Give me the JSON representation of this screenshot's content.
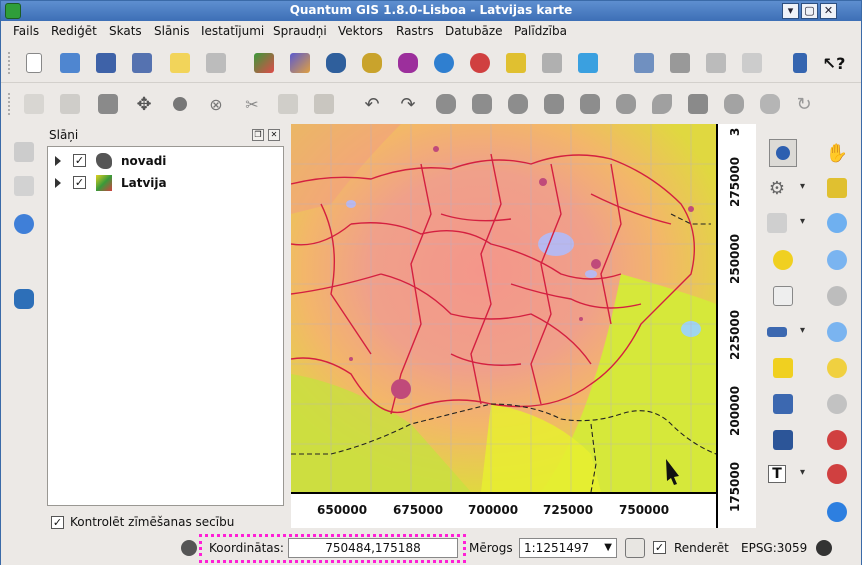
{
  "window": {
    "title": "Quantum GIS 1.8.0-Lisboa - Latvijas karte",
    "minimize": "▾",
    "maximize": "▢",
    "close": "✕"
  },
  "menu": [
    "Fails",
    "Rediģēt",
    "Skats",
    "Slānis",
    "Iestatījumi",
    "Spraudņi",
    "Vektors",
    "Rastrs",
    "Datubāze",
    "Palīdzība"
  ],
  "toolbar_top_icons": [
    "new-project-icon",
    "open-project-icon",
    "save-project-icon",
    "save-as-icon",
    "new-print-composer-icon",
    "print-icon",
    "add-raster-layer-icon",
    "add-wms-layer-icon",
    "add-postgis-layer-icon",
    "add-spatialite-layer-icon",
    "add-mssql-layer-icon",
    "add-wfs-layer-icon",
    "add-delimited-text-icon",
    "add-gpx-icon",
    "remove-layer-icon",
    "new-vector-layer-icon",
    "spell-check-icon",
    "measure-icon",
    "tag-icon",
    "plugin-icon",
    "help-book-icon",
    "whats-this-icon"
  ],
  "toolbar_edit_icons": [
    "edit-pencil-icon",
    "save-edits-icon",
    "add-feature-icon",
    "move-feature-icon",
    "node-tool-icon",
    "delete-selected-icon",
    "cut-icon",
    "copy-icon",
    "paste-icon",
    "undo-icon",
    "redo-icon",
    "simplify-icon",
    "add-ring-icon",
    "add-part-icon",
    "delete-ring-icon",
    "delete-part-icon",
    "reshape-icon",
    "offset-curve-icon",
    "split-icon",
    "merge-icon",
    "merge-attributes-icon",
    "rotate-icon"
  ],
  "layers_panel": {
    "title": "Slāņi",
    "layers": [
      {
        "name": "novadi",
        "checked": true,
        "icon": "polygon-layer-icon"
      },
      {
        "name": "Latvija",
        "checked": true,
        "icon": "raster-layer-icon"
      }
    ],
    "render_order_label": "Kontrolēt zīmēšanas secību",
    "render_order_checked": true
  },
  "map": {
    "x_ticks": [
      "650000",
      "675000",
      "700000",
      "725000",
      "750000"
    ],
    "y_ticks": [
      "275000",
      "250000",
      "225000",
      "200000",
      "175000"
    ],
    "y_top_label": "3"
  },
  "status": {
    "coord_label": "Koordinātas:",
    "coord_value": "750484,175188",
    "scale_label": "Mērogs",
    "scale_value": "1:1251497",
    "render_label": "Renderēt",
    "render_checked": true,
    "crs": "EPSG:3059"
  },
  "check_mark": "✓"
}
